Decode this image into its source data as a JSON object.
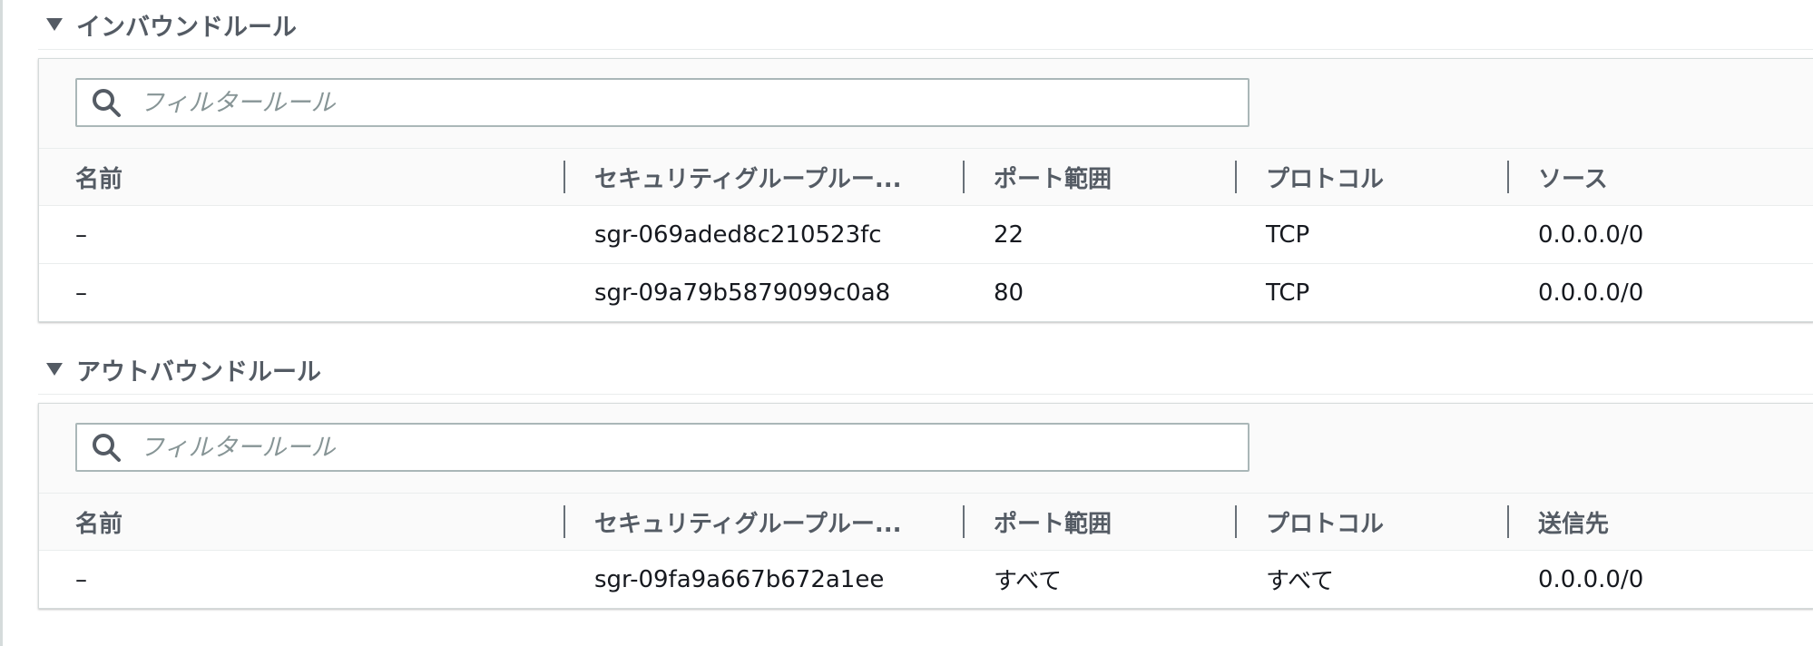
{
  "inbound": {
    "title": "インバウンドルール",
    "filter_placeholder": "フィルタールール",
    "columns": [
      "名前",
      "セキュリティグループルー...",
      "ポート範囲",
      "プロトコル",
      "ソース"
    ],
    "rows": [
      {
        "name": "–",
        "rule_id": "sgr-069aded8c210523fc",
        "port_range": "22",
        "protocol": "TCP",
        "source": "0.0.0.0/0"
      },
      {
        "name": "–",
        "rule_id": "sgr-09a79b5879099c0a8",
        "port_range": "80",
        "protocol": "TCP",
        "source": "0.0.0.0/0"
      }
    ]
  },
  "outbound": {
    "title": "アウトバウンドルール",
    "filter_placeholder": "フィルタールール",
    "columns": [
      "名前",
      "セキュリティグループルー...",
      "ポート範囲",
      "プロトコル",
      "送信先"
    ],
    "rows": [
      {
        "name": "–",
        "rule_id": "sgr-09fa9a667b672a1ee",
        "port_range": "すべて",
        "protocol": "すべて",
        "destination": "0.0.0.0/0"
      }
    ]
  },
  "icons": {
    "caret": "caret-down-icon",
    "search": "search-icon"
  }
}
